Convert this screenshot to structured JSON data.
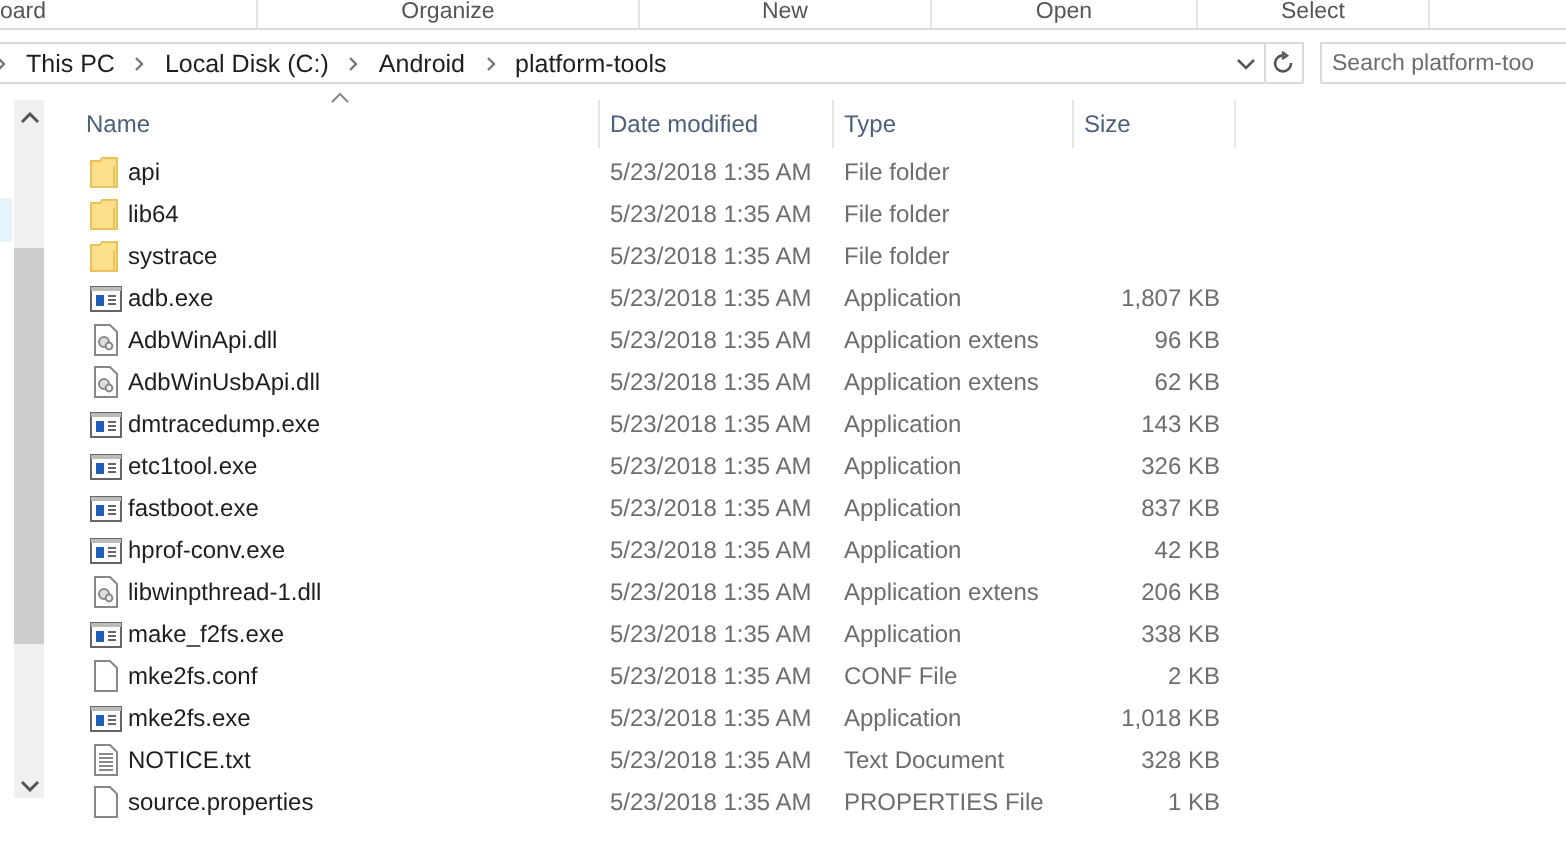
{
  "ribbon": {
    "groups": [
      "oard",
      "Organize",
      "New",
      "Open",
      "Select"
    ]
  },
  "address_bar": {
    "path": [
      "This PC",
      "Local Disk (C:)",
      "Android",
      "platform-tools"
    ]
  },
  "search": {
    "placeholder": "Search platform-too"
  },
  "columns": [
    {
      "label": "Name",
      "sorted": true
    },
    {
      "label": "Date modified",
      "sorted": false
    },
    {
      "label": "Type",
      "sorted": false
    },
    {
      "label": "Size",
      "sorted": false
    }
  ],
  "rows": [
    {
      "kind": "folder",
      "name": "api",
      "date": "5/23/2018 1:35 AM",
      "type": "File folder",
      "size": ""
    },
    {
      "kind": "folder",
      "name": "lib64",
      "date": "5/23/2018 1:35 AM",
      "type": "File folder",
      "size": ""
    },
    {
      "kind": "folder",
      "name": "systrace",
      "date": "5/23/2018 1:35 AM",
      "type": "File folder",
      "size": ""
    },
    {
      "kind": "exe",
      "name": "adb.exe",
      "date": "5/23/2018 1:35 AM",
      "type": "Application",
      "size": "1,807 KB"
    },
    {
      "kind": "dll",
      "name": "AdbWinApi.dll",
      "date": "5/23/2018 1:35 AM",
      "type": "Application extens",
      "size": "96 KB"
    },
    {
      "kind": "dll",
      "name": "AdbWinUsbApi.dll",
      "date": "5/23/2018 1:35 AM",
      "type": "Application extens",
      "size": "62 KB"
    },
    {
      "kind": "exe",
      "name": "dmtracedump.exe",
      "date": "5/23/2018 1:35 AM",
      "type": "Application",
      "size": "143 KB"
    },
    {
      "kind": "exe",
      "name": "etc1tool.exe",
      "date": "5/23/2018 1:35 AM",
      "type": "Application",
      "size": "326 KB"
    },
    {
      "kind": "exe",
      "name": "fastboot.exe",
      "date": "5/23/2018 1:35 AM",
      "type": "Application",
      "size": "837 KB"
    },
    {
      "kind": "exe",
      "name": "hprof-conv.exe",
      "date": "5/23/2018 1:35 AM",
      "type": "Application",
      "size": "42 KB"
    },
    {
      "kind": "dll",
      "name": "libwinpthread-1.dll",
      "date": "5/23/2018 1:35 AM",
      "type": "Application extens",
      "size": "206 KB"
    },
    {
      "kind": "exe",
      "name": "make_f2fs.exe",
      "date": "5/23/2018 1:35 AM",
      "type": "Application",
      "size": "338 KB"
    },
    {
      "kind": "file",
      "name": "mke2fs.conf",
      "date": "5/23/2018 1:35 AM",
      "type": "CONF File",
      "size": "2 KB"
    },
    {
      "kind": "exe",
      "name": "mke2fs.exe",
      "date": "5/23/2018 1:35 AM",
      "type": "Application",
      "size": "1,018 KB"
    },
    {
      "kind": "text",
      "name": "NOTICE.txt",
      "date": "5/23/2018 1:35 AM",
      "type": "Text Document",
      "size": "328 KB"
    },
    {
      "kind": "file",
      "name": "source.properties",
      "date": "5/23/2018 1:35 AM",
      "type": "PROPERTIES File",
      "size": "1 KB"
    }
  ]
}
